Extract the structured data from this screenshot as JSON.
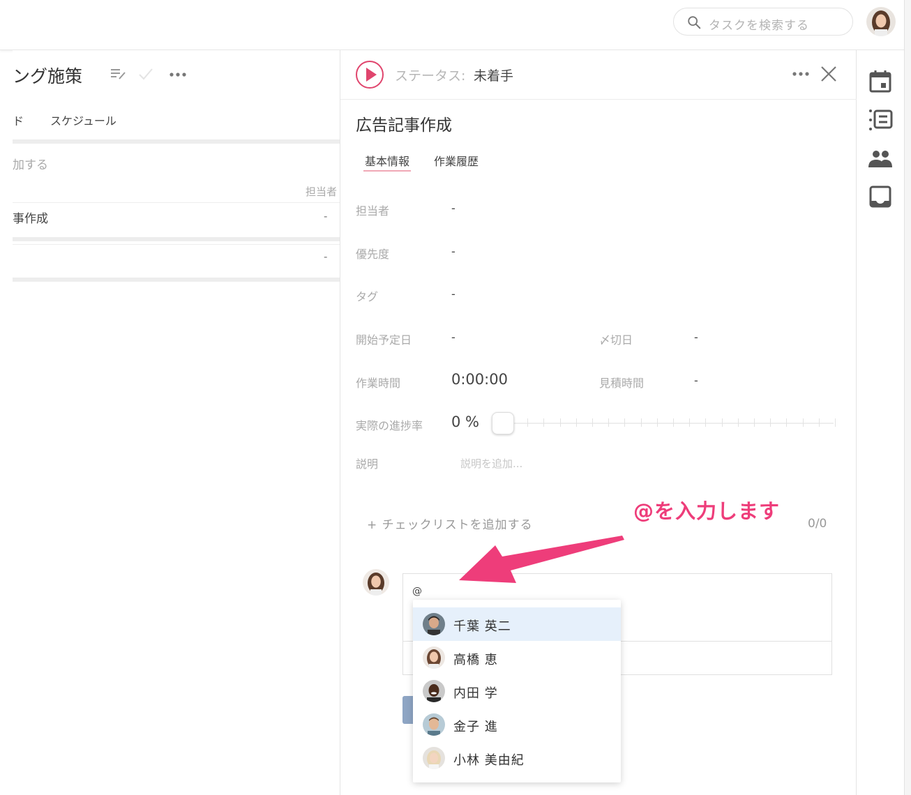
{
  "topbar": {
    "search_placeholder": "タスクを検索する"
  },
  "left_panel": {
    "project_title": "ング施策",
    "tabs": [
      "ド",
      "スケジュール"
    ],
    "add_task": "加する",
    "col_assignee": "担当者",
    "rows": [
      {
        "name": "事作成",
        "assignee": "-"
      },
      {
        "name": "",
        "assignee": "-"
      }
    ]
  },
  "detail": {
    "status_label": "ステータス:",
    "status_value": "未着手",
    "task_title": "広告記事作成",
    "tabs": [
      "基本情報",
      "作業履歴"
    ],
    "fields": {
      "assignee_label": "担当者",
      "assignee_value": "-",
      "priority_label": "優先度",
      "priority_value": "-",
      "tag_label": "タグ",
      "tag_value": "-",
      "start_label": "開始予定日",
      "start_value": "-",
      "deadline_label": "〆切日",
      "deadline_value": "-",
      "worktime_label": "作業時間",
      "worktime_value": "0:00:00",
      "estimate_label": "見積時間",
      "estimate_value": "-",
      "progress_label": "実際の進捗率",
      "progress_value": "0 %",
      "progress_fraction": 0,
      "desc_label": "説明",
      "desc_placeholder": "説明を追加..."
    },
    "checklist_add": "+ チェックリストを追加する",
    "checklist_count": "0/0",
    "comment_input": "@"
  },
  "mention_dropdown": {
    "items": [
      {
        "name": "千葉 英二",
        "selected": true
      },
      {
        "name": "高橋 恵",
        "selected": false
      },
      {
        "name": "内田 学",
        "selected": false
      },
      {
        "name": "金子 進",
        "selected": false
      },
      {
        "name": "小林 美由紀",
        "selected": false
      }
    ]
  },
  "annotation": {
    "text": "@を入力します",
    "color": "#ee3d7a"
  },
  "colors": {
    "accent": "#e0456d",
    "selected_row": "#e6f0fb",
    "icon_gray": "#555555"
  }
}
